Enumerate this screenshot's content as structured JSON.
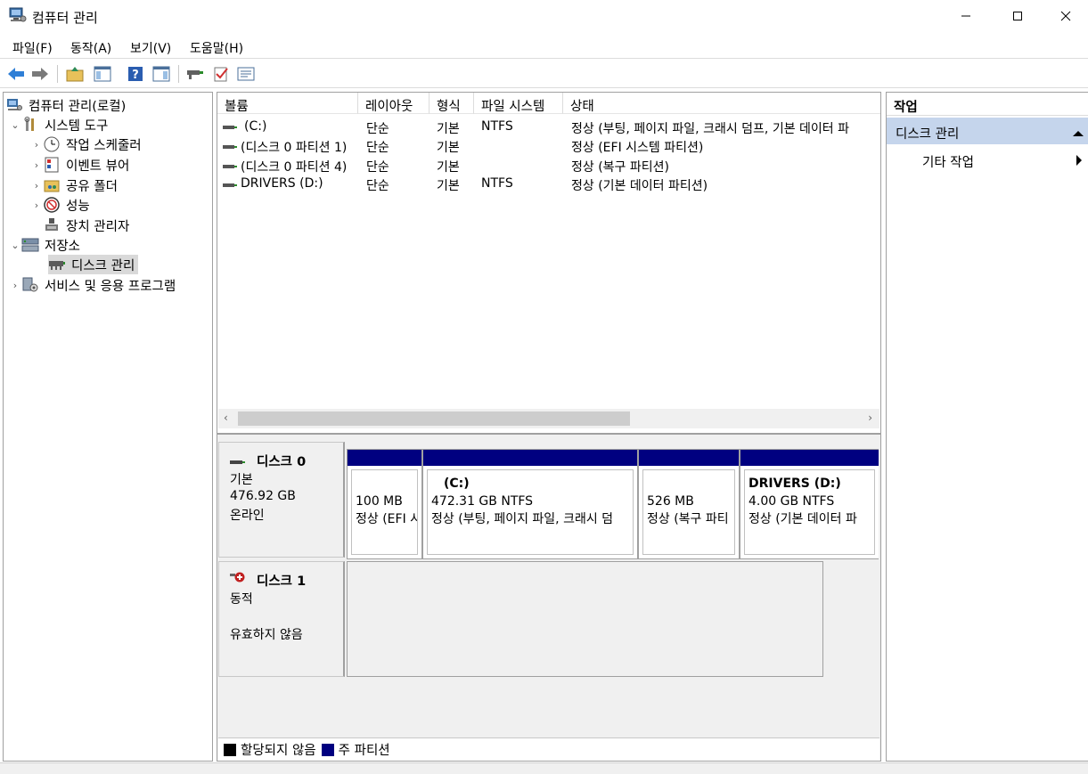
{
  "window": {
    "title": "컴퓨터 관리"
  },
  "menu": [
    "파일(F)",
    "동작(A)",
    "보기(V)",
    "도움말(H)"
  ],
  "tree": {
    "root": "컴퓨터 관리(로컬)",
    "system_tools": "시스템 도구",
    "task_scheduler": "작업 스케줄러",
    "event_viewer": "이벤트 뷰어",
    "shared_folders": "공유 폴더",
    "performance": "성능",
    "device_manager": "장치 관리자",
    "storage": "저장소",
    "disk_management": "디스크 관리",
    "services_apps": "서비스 및 응용 프로그램"
  },
  "volume_table": {
    "headers": [
      "볼륨",
      "레이아웃",
      "형식",
      "파일 시스템",
      "상태"
    ],
    "rows": [
      [
        "(C:)",
        "단순",
        "기본",
        "NTFS",
        "정상 (부팅, 페이지 파일, 크래시 덤프, 기본 데이터 파"
      ],
      [
        "(디스크 0 파티션 1)",
        "단순",
        "기본",
        "",
        "정상 (EFI 시스템 파티션)"
      ],
      [
        "(디스크 0 파티션 4)",
        "단순",
        "기본",
        "",
        "정상 (복구 파티션)"
      ],
      [
        "DRIVERS (D:)",
        "단순",
        "기본",
        "NTFS",
        "정상 (기본 데이터 파티션)"
      ]
    ]
  },
  "disks": [
    {
      "name": "디스크 0",
      "type": "기본",
      "size": "476.92 GB",
      "status": "온라인",
      "partitions": [
        {
          "label": "",
          "size": "100 MB",
          "status": "정상 (EFI 시"
        },
        {
          "label": "(C:)",
          "size": "472.31 GB NTFS",
          "status": "정상 (부팅, 페이지 파일, 크래시 덤"
        },
        {
          "label": "",
          "size": "526 MB",
          "status": "정상 (복구 파티"
        },
        {
          "label": "DRIVERS  (D:)",
          "size": "4.00 GB NTFS",
          "status": "정상 (기본 데이터 파"
        }
      ]
    },
    {
      "name": "디스크 1",
      "type": "동적",
      "size": "",
      "status": "유효하지 않음"
    }
  ],
  "legend": {
    "unallocated": "할당되지 않음",
    "primary": "주 파티션"
  },
  "actions": {
    "header": "작업",
    "section": "디스크 관리",
    "more": "기타 작업"
  },
  "colors": {
    "primary_partition": "#000080",
    "unallocated": "#000000",
    "action_section_bg": "#c5d5ec"
  },
  "icons": [
    "computer-management-icon",
    "minimize-icon",
    "maximize-icon",
    "close-icon",
    "back-icon",
    "forward-icon",
    "up-folder-icon",
    "show-hide-tree-icon",
    "help-icon",
    "action-pane-icon",
    "connect-icon",
    "check-icon",
    "properties-icon"
  ]
}
